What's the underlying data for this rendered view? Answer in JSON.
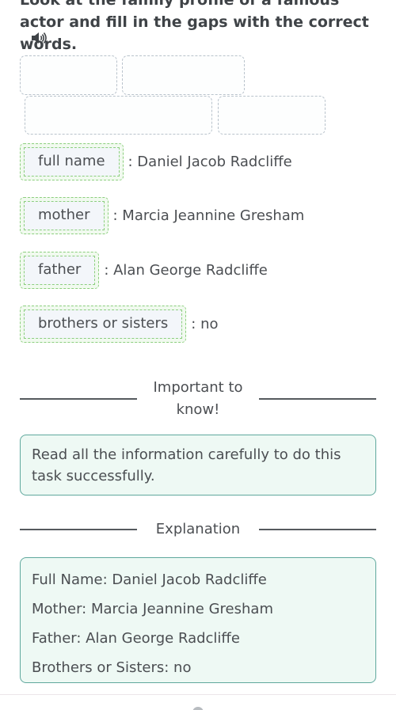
{
  "task": {
    "instruction": "Look at the family profile of a famous actor and fill in the gaps with the correct words.",
    "audio_icon": "speaker-icon"
  },
  "word_bank": {
    "empty_slots": 4
  },
  "gaps": [
    {
      "answer": "full name",
      "value": ": Daniel Jacob Radcliffe"
    },
    {
      "answer": "mother",
      "value": ": Marcia Jeannine Gresham"
    },
    {
      "answer": "father",
      "value": ": Alan George Radcliffe"
    },
    {
      "answer": "brothers or sisters",
      "value": ": no"
    }
  ],
  "important": {
    "heading": "Important to know!",
    "text": "Read all the information carefully to do this task successfully."
  },
  "explanation": {
    "heading": "Explanation",
    "lines": [
      "Full Name: Daniel Jacob Radcliffe",
      "Mother: Marcia Jeannine Gresham",
      "Father: Alan George Radcliffe",
      "Brothers or Sisters: no"
    ]
  },
  "colors": {
    "gap_border": "#8ccf7e",
    "gap_background": "#f1faef",
    "info_border": "#5fa89d",
    "info_background": "#eef9f4",
    "text": "#4b4e52"
  }
}
